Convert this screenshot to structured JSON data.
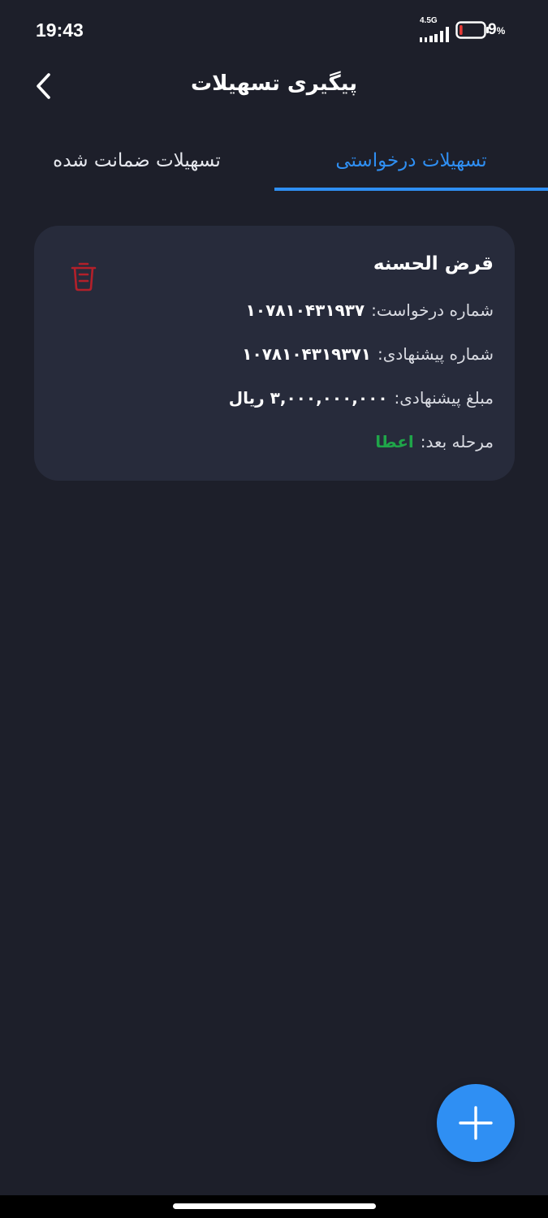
{
  "status_bar": {
    "time": "19:43",
    "network": "4.5G",
    "battery_percent": "9",
    "battery_unit": "%",
    "battery_level": 0.09,
    "battery_level_color": "#e53935"
  },
  "header": {
    "title": "پیگیری تسهیلات",
    "back_icon": "chevron-left-icon"
  },
  "tabs": [
    {
      "label": "تسهیلات درخواستی",
      "active": true
    },
    {
      "label": "تسهیلات ضمانت شده",
      "active": false
    }
  ],
  "card": {
    "title": "قرض الحسنه",
    "delete_icon": "trash-icon",
    "rows": [
      {
        "label": "شماره درخواست:",
        "value": "۱۰۷۸۱۰۴۳۱۹۳۷"
      },
      {
        "label": "شماره پیشنهادی:",
        "value": "۱۰۷۸۱۰۴۳۱۹۳۷۱"
      },
      {
        "label": "مبلغ پیشنهادی:",
        "value": "۳,۰۰۰,۰۰۰,۰۰۰ ریال"
      },
      {
        "label": "مرحله بعد:",
        "value": "اعطا"
      }
    ]
  },
  "fab": {
    "icon": "plus-icon"
  },
  "colors": {
    "background": "#1d1f2a",
    "card": "#272b3b",
    "accent": "#2f8ff3",
    "delete": "#b3202a",
    "next_step": "#1fa549"
  }
}
